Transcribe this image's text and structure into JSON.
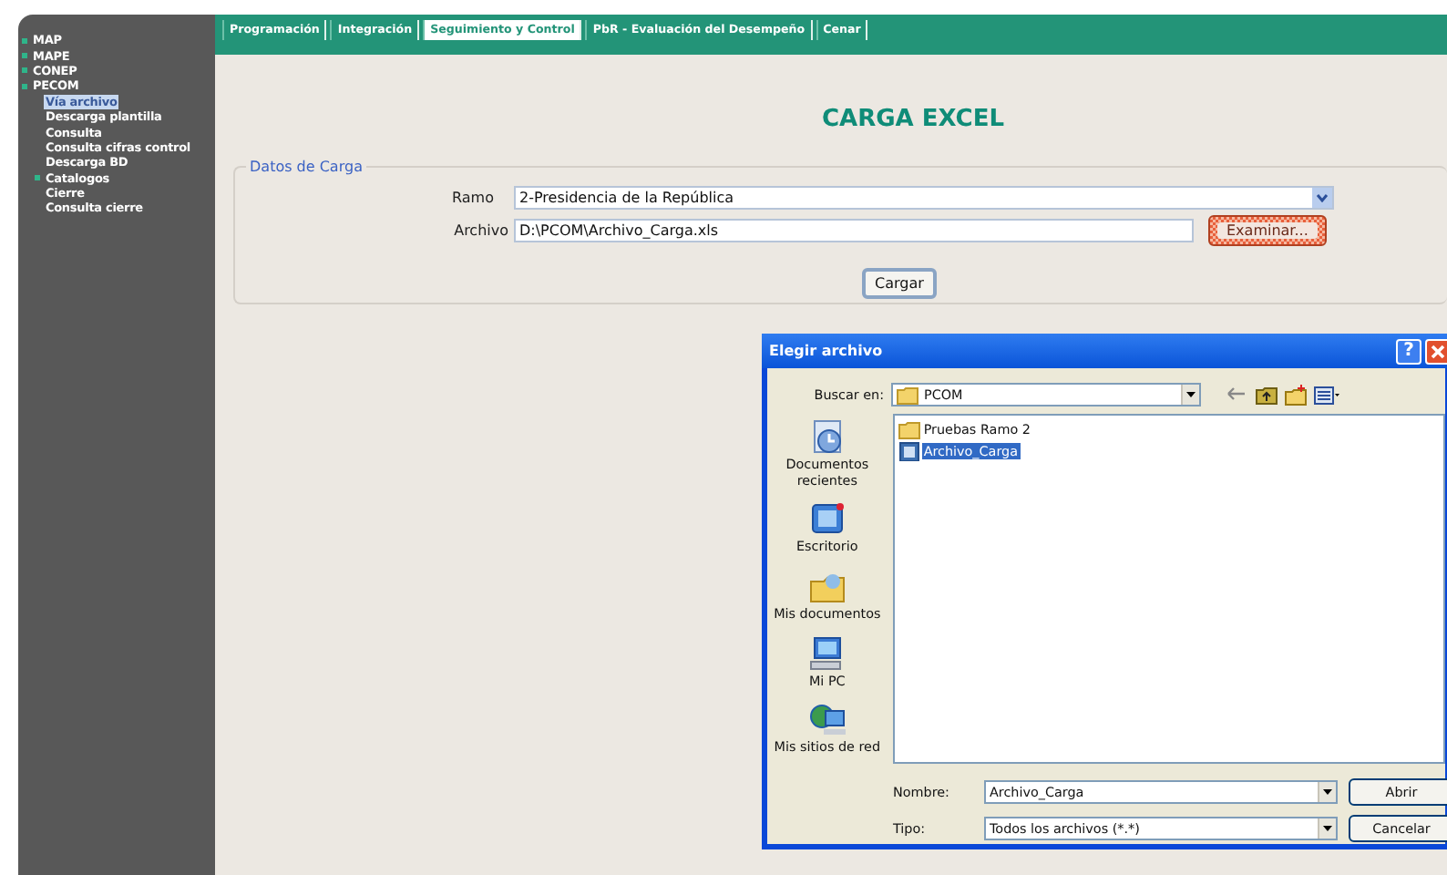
{
  "sidebar": {
    "items": [
      {
        "label": "MAP",
        "kind": "section",
        "selected": false
      },
      {
        "label": "MAPE",
        "kind": "section",
        "selected": false
      },
      {
        "label": "CONEP",
        "kind": "section",
        "selected": false
      },
      {
        "label": "PECOM",
        "kind": "section",
        "selected": false,
        "children": [
          {
            "label": "Vía archivo",
            "kind": "leaf",
            "selected": true
          },
          {
            "label": "Descarga plantilla",
            "kind": "leaf",
            "selected": false
          },
          {
            "label": "Consulta",
            "kind": "leaf",
            "selected": false
          },
          {
            "label": "Consulta cifras control",
            "kind": "leaf",
            "selected": false
          },
          {
            "label": "Descarga BD",
            "kind": "leaf",
            "selected": false
          },
          {
            "label": "Catalogos",
            "kind": "section",
            "selected": false
          },
          {
            "label": "Cierre",
            "kind": "leaf",
            "selected": false
          },
          {
            "label": "Consulta cierre",
            "kind": "leaf",
            "selected": false
          }
        ]
      }
    ]
  },
  "tabs": [
    {
      "label": "Programación",
      "selected": false
    },
    {
      "label": "Integración",
      "selected": false
    },
    {
      "label": "Seguimiento y Control",
      "selected": true
    },
    {
      "label": "PbR - Evaluación del Desempeño",
      "selected": false
    },
    {
      "label": "Cenar",
      "selected": false
    }
  ],
  "page": {
    "title": "CARGA EXCEL",
    "form": {
      "legend": "Datos de Carga",
      "ramo": {
        "label": "Ramo",
        "value": "2-Presidencia de la República"
      },
      "archivo": {
        "label": "Archivo",
        "value": "D:\\PCOM\\Archivo_Carga.xls"
      },
      "browse_button": {
        "label": "Examinar...",
        "highlighted": true
      },
      "submit_button": {
        "label": "Cargar"
      }
    }
  },
  "dialog": {
    "title": "Elegir archivo",
    "help": "?",
    "look_in": {
      "label": "Buscar en:",
      "value": "PCOM"
    },
    "places": [
      {
        "label": "Documentos recientes",
        "kind": "recent"
      },
      {
        "label": "Escritorio",
        "kind": "desktop"
      },
      {
        "label": "Mis documentos",
        "kind": "documents"
      },
      {
        "label": "Mi PC",
        "kind": "computer"
      },
      {
        "label": "Mis sitios de red",
        "kind": "network"
      }
    ],
    "files": [
      {
        "name": "Pruebas Ramo 2",
        "kind": "folder",
        "selected": false
      },
      {
        "name": "Archivo_Carga",
        "kind": "file",
        "selected": true
      }
    ],
    "name_field": {
      "label": "Nombre:",
      "value": "Archivo_Carga"
    },
    "type_field": {
      "label": "Tipo:",
      "value": "Todos los archivos (*.*)"
    },
    "open_button": {
      "label": "Abrir"
    },
    "cancel_button": {
      "label": "Cancelar"
    }
  }
}
